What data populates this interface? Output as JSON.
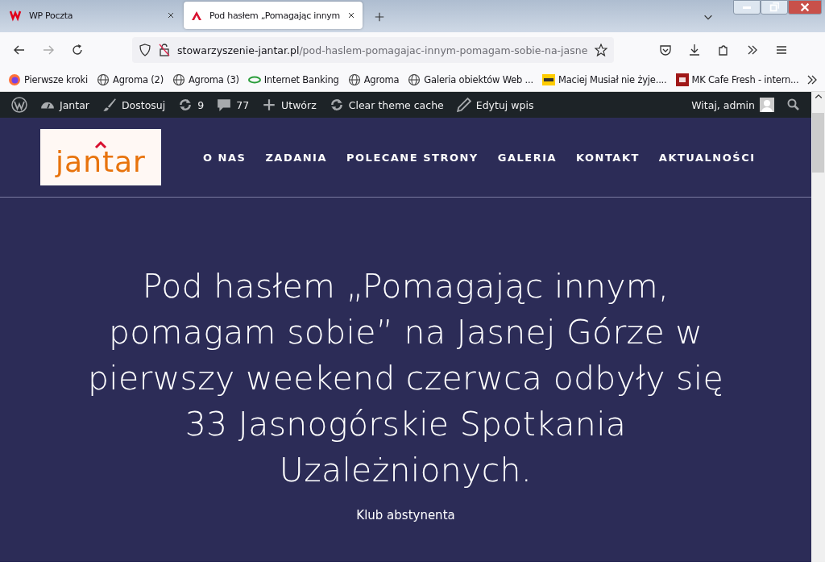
{
  "tabs": [
    {
      "title": "WP Poczta",
      "selected": false
    },
    {
      "title": "Pod hasłem „Pomagając innym",
      "selected": true
    }
  ],
  "address_bar": {
    "domain": "stowarzyszenie-jantar.pl",
    "path": "/pod-haslem-pomagajac-innym-pomagam-sobie-na-jasne"
  },
  "bookmarks": [
    {
      "label": "Pierwsze kroki",
      "kind": "firefox"
    },
    {
      "label": "Agroma (2)",
      "kind": "globe"
    },
    {
      "label": "Agroma (3)",
      "kind": "globe"
    },
    {
      "label": "Internet Banking",
      "kind": "bank"
    },
    {
      "label": "Agroma",
      "kind": "globe"
    },
    {
      "label": "Galeria obiektów Web ...",
      "kind": "globe"
    },
    {
      "label": "Maciej Musiał nie żyje....",
      "kind": "rmf"
    },
    {
      "label": "MK Cafe Fresh - intern...",
      "kind": "cafe"
    }
  ],
  "admin_bar": {
    "items": [
      {
        "label": "Jantar",
        "kind": "dashboard"
      },
      {
        "label": "Dostosuj",
        "kind": "brush"
      },
      {
        "label": "9",
        "kind": "update"
      },
      {
        "label": "77",
        "kind": "comment"
      },
      {
        "label": "Utwórz",
        "kind": "plus"
      },
      {
        "label": "Clear theme cache",
        "kind": "update"
      },
      {
        "label": "Edytuj wpis",
        "kind": "pencil"
      }
    ],
    "greeting": "Witaj, admin"
  },
  "site_header": {
    "logo_text": "jantar",
    "menu": [
      "O NAS",
      "ZADANIA",
      "POLECANE STRONY",
      "GALERIA",
      "KONTAKT",
      "AKTUALNOŚCI"
    ]
  },
  "hero": {
    "title": "Pod hasłem „Pomagając innym, pomagam sobie” na Jasnej Górze w pierwszy weekend czerwca odbyły się 33 Jasnogórskie Spotkania Uzależnionych.",
    "category": "Klub abstynenta"
  }
}
